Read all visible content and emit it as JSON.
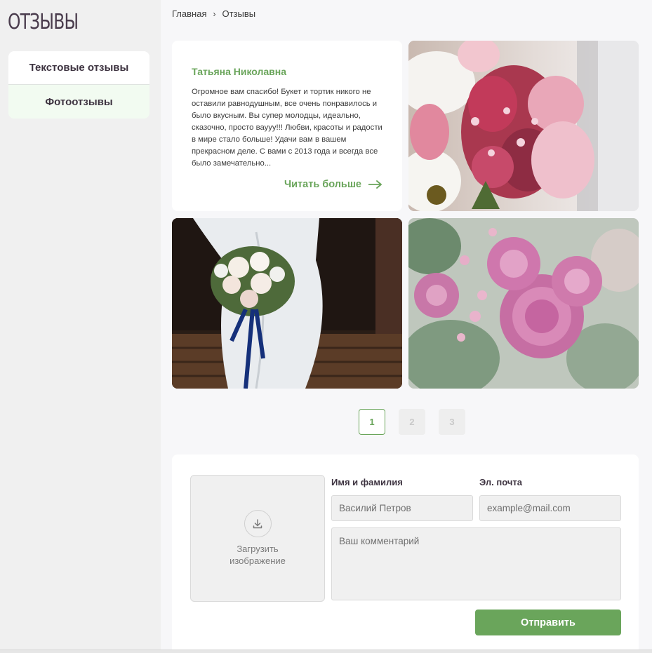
{
  "sidebar": {
    "title": "ОТЗЫВЫ",
    "items": [
      {
        "label": "Текстовые отзывы"
      },
      {
        "label": "Фотоотзывы"
      }
    ]
  },
  "breadcrumb": {
    "home": "Главная",
    "separator": "›",
    "current": "Отзывы"
  },
  "review": {
    "name": "Татьяна Николавна",
    "text": "Огромное вам спасибо! Букет и тортик никого не оставили равнодушным, все очень понравилось и было вкусным. Вы супер молодцы, идеально, сказочно, просто вауyy!!! Любви, красоты и радости в мире стало больше! Удачи вам в вашем прекрасном деле. С вами с 2013 года и всегда все было замечательно...",
    "read_more": "Читать больше"
  },
  "photos": [
    {
      "name": "photo-bouquet-lilies"
    },
    {
      "name": "photo-wedding-bouquet"
    },
    {
      "name": "photo-pink-roses"
    }
  ],
  "pagination": {
    "pages": [
      "1",
      "2",
      "3"
    ],
    "current": "1"
  },
  "form": {
    "upload_label": "Загрузить изображение",
    "name_label": "Имя и фамилия",
    "name_placeholder": "Василий Петров",
    "email_label": "Эл. почта",
    "email_placeholder": "example@mail.com",
    "comment_placeholder": "Ваш комментарий",
    "submit_label": "Отправить"
  },
  "colors": {
    "accent": "#6aa55b",
    "sidebar_bg": "#f0f0f0",
    "title": "#4a3c4d"
  },
  "icons": {
    "upload": "download-tray-icon",
    "read_more": "arrow-right-icon"
  }
}
